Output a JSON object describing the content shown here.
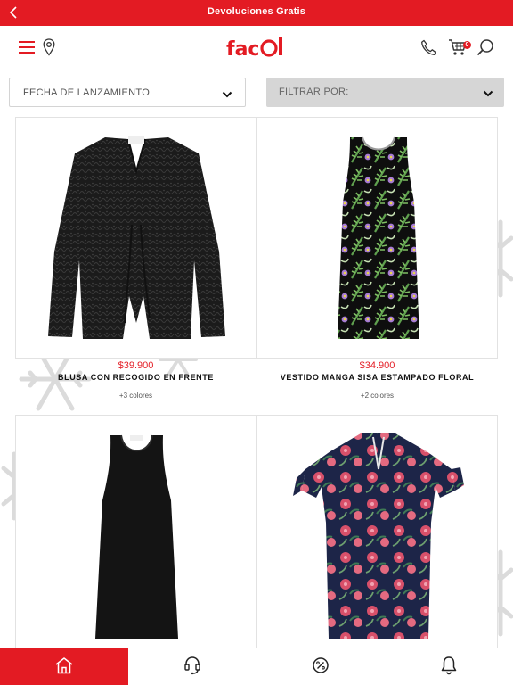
{
  "promo": {
    "title": "Devoluciones Gratis"
  },
  "header": {
    "logo": "facol",
    "cart_count": "0"
  },
  "filters": {
    "sort_label": "FECHA DE LANZAMIENTO",
    "filter_label": "FILTRAR POR:"
  },
  "products": [
    {
      "price": "$39.900",
      "name": "BLUSA CON RECOGIDO EN FRENTE",
      "colors": "+3 colores"
    },
    {
      "price": "$34.900",
      "name": "VESTIDO MANGA SISA ESTAMPADO FLORAL",
      "colors": "+2 colores"
    },
    {
      "price": "",
      "name": "",
      "colors": ""
    },
    {
      "price": "",
      "name": "",
      "colors": ""
    }
  ],
  "colors": {
    "accent": "#e31b23",
    "filter_bg": "#d6d6d6",
    "border": "#e2e2e2"
  },
  "icons": [
    "back-chevron-icon",
    "menu-icon",
    "location-pin-icon",
    "phone-icon",
    "cart-icon",
    "search-icon",
    "chevron-down-icon",
    "home-icon",
    "headset-icon",
    "discount-icon",
    "bell-icon"
  ]
}
